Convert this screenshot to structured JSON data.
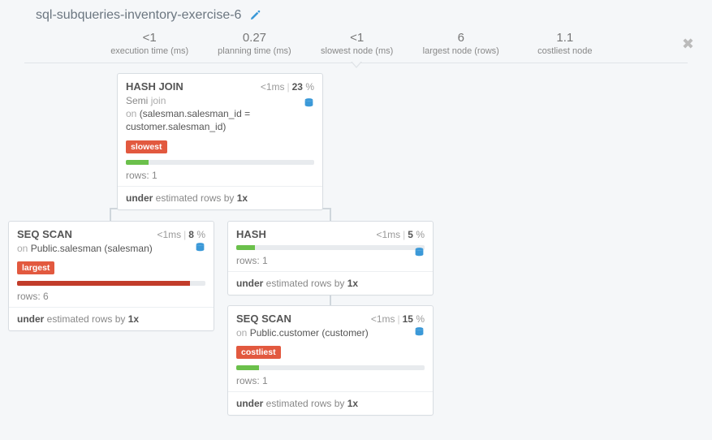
{
  "title": "sql-subqueries-inventory-exercise-6",
  "stats": [
    {
      "value": "<1",
      "label": "execution time (ms)"
    },
    {
      "value": "0.27",
      "label": "planning time (ms)"
    },
    {
      "value": "<1",
      "label": "slowest node (ms)"
    },
    {
      "value": "6",
      "label": "largest node (rows)"
    },
    {
      "value": "1.1",
      "label": "costliest node"
    }
  ],
  "nodes": {
    "hashjoin": {
      "title": "HASH JOIN",
      "time": "<1ms",
      "pct": "23",
      "sub_pre": "Semi ",
      "sub_kw": "join",
      "sub_line2_pre": "on ",
      "sub_line2": "(salesman.salesman_id = customer.salesman_id)",
      "tag": "slowest",
      "rows": "rows: 1",
      "footer_pre": "under",
      "footer_mid": " estimated rows by ",
      "footer_val": "1x"
    },
    "seqscan1": {
      "title": "SEQ SCAN",
      "time": "<1ms",
      "pct": "8",
      "sub_pre": "on ",
      "sub_val": "Public.salesman (salesman)",
      "tag": "largest",
      "rows": "rows: 6",
      "footer_pre": "under",
      "footer_mid": " estimated rows by ",
      "footer_val": "1x"
    },
    "hash": {
      "title": "HASH",
      "time": "<1ms",
      "pct": "5",
      "rows": "rows: 1",
      "footer_pre": "under",
      "footer_mid": " estimated rows by ",
      "footer_val": "1x"
    },
    "seqscan2": {
      "title": "SEQ SCAN",
      "time": "<1ms",
      "pct": "15",
      "sub_pre": "on ",
      "sub_val": "Public.customer (customer)",
      "tag": "costliest",
      "rows": "rows: 1",
      "footer_pre": "under",
      "footer_mid": " estimated rows by ",
      "footer_val": "1x"
    }
  }
}
